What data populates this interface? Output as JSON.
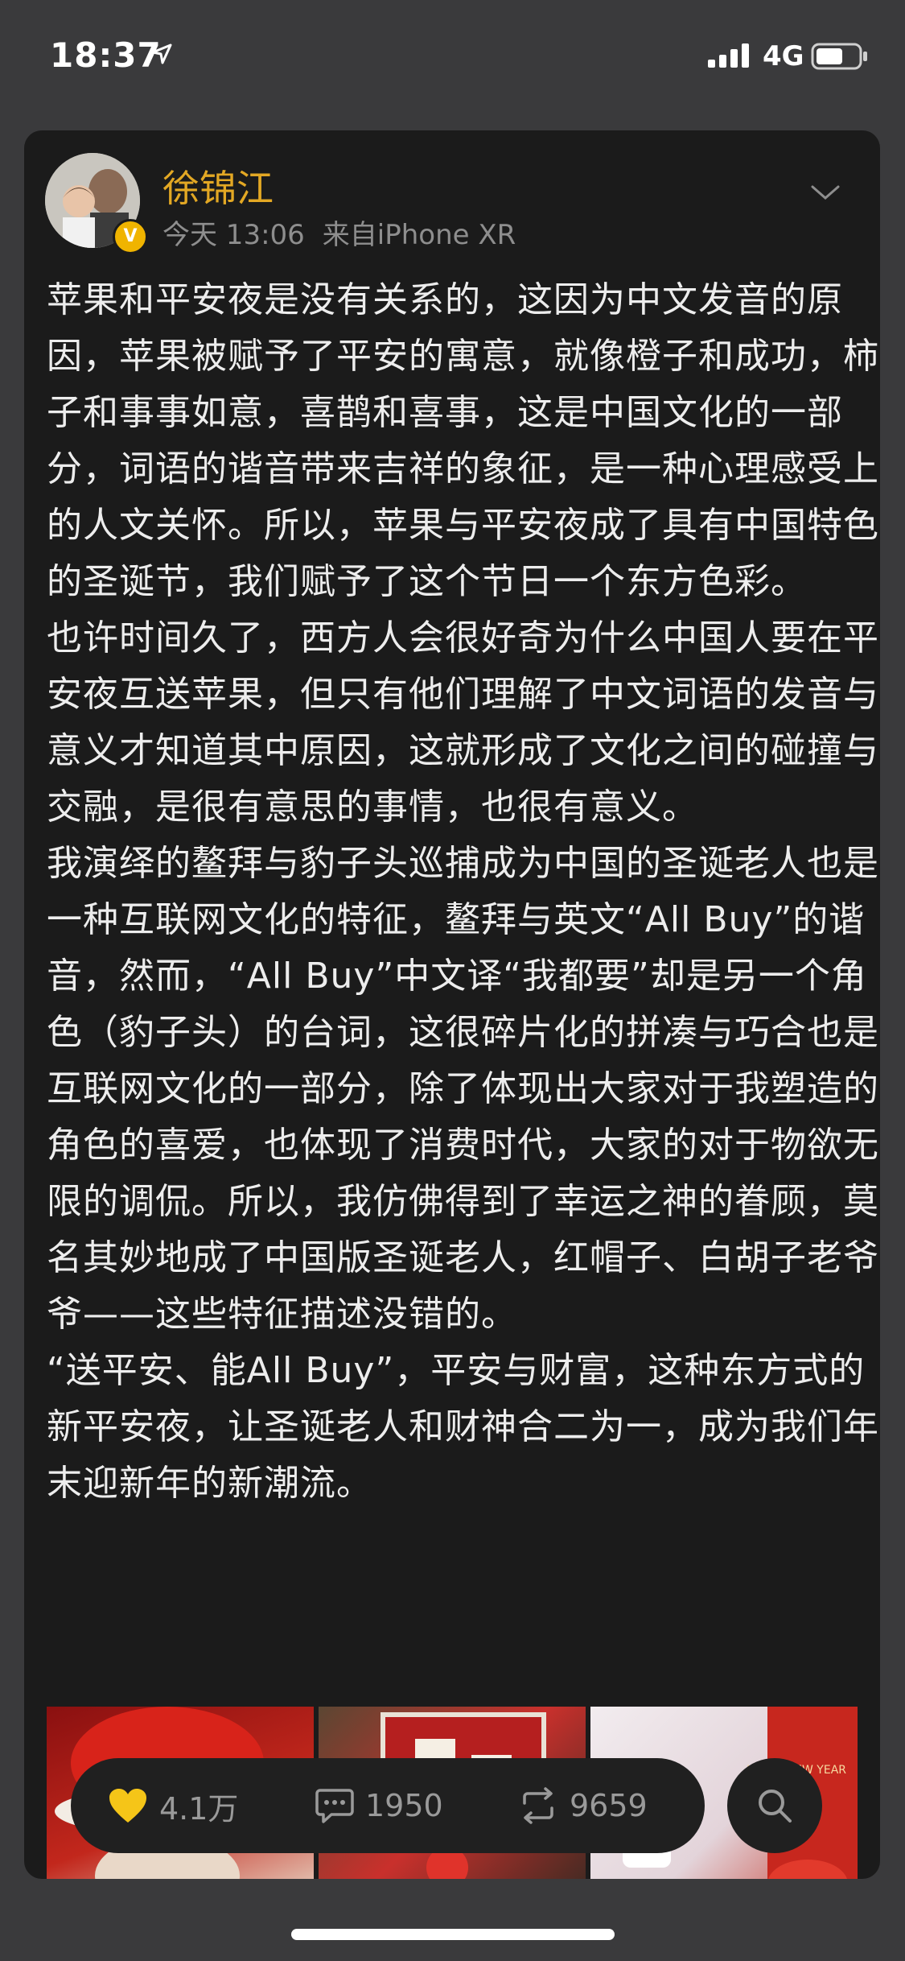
{
  "status_bar": {
    "time": "18:37",
    "network": "4G"
  },
  "post": {
    "author": {
      "name": "徐锦江",
      "verified_badge": "V"
    },
    "timestamp": "今天 13:06",
    "source": "来自iPhone XR",
    "paragraphs": [
      "苹果和平安夜是没有关系的，这因为中文发音的原因，苹果被赋予了平安的寓意，就像橙子和成功，柿子和事事如意，喜鹊和喜事，这是中国文化的一部分，词语的谐音带来吉祥的象征，是一种心理感受上的人文关怀。所以，苹果与平安夜成了具有中国特色的圣诞节，我们赋予了这个节日一个东方色彩。",
      "也许时间久了，西方人会很好奇为什么中国人要在平安夜互送苹果，但只有他们理解了中文词语的发音与意义才知道其中原因，这就形成了文化之间的碰撞与交融，是很有意思的事情，也很有意义。",
      "我演绎的鳌拜与豹子头巡捕成为中国的圣诞老人也是一种互联网文化的特征，鳌拜与英文“All Buy”的谐音，然而，“All Buy”中文译“我都要”却是另一个角色（豹子头）的台词，这很碎片化的拼凑与巧合也是互联网文化的一部分，除了体现出大家对于我塑造的角色的喜爱，也体现了消费时代，大家的对于物欲无限的调侃。所以，我仿佛得到了幸运之神的眷顾，莫名其妙地成了中国版圣诞老人，红帽子、白胡子老爷爷——这些特征描述没错的。",
      "“送平安、能All Buy”，平安与财富，这种东方式的新平安夜，让圣诞老人和财神合二为一，成为我们年末迎新年的新潮流。"
    ]
  },
  "images": {
    "thumb3_text": "HAPPY NEW YEAR"
  },
  "actions": {
    "likes": "4.1万",
    "comments": "1950",
    "reposts": "9659"
  },
  "icons": {
    "like": "heart-icon",
    "comment": "comment-icon",
    "repost": "repost-icon",
    "search": "search-icon",
    "more": "chevron-down-icon"
  },
  "colors": {
    "background": "#3a3a3c",
    "card": "#1b1b1b",
    "author_name": "#e3a824",
    "like_heart": "#f5c518"
  }
}
